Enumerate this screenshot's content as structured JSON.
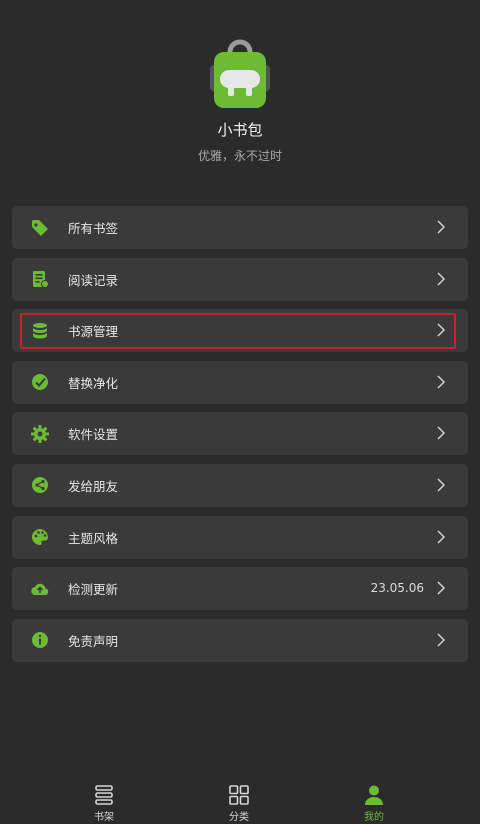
{
  "app": {
    "name": "小书包",
    "slogan": "优雅，永不过时"
  },
  "colors": {
    "accent": "#6cbb34",
    "background": "#2b2b2b",
    "card": "#3a3a3a",
    "highlight": "#c8232c"
  },
  "menu": [
    {
      "id": "bookmarks",
      "label": "所有书签",
      "icon": "tag-icon"
    },
    {
      "id": "history",
      "label": "阅读记录",
      "icon": "reading-log-icon"
    },
    {
      "id": "sources",
      "label": "书源管理",
      "icon": "database-icon"
    },
    {
      "id": "replace",
      "label": "替换净化",
      "icon": "brush-check-icon"
    },
    {
      "id": "settings",
      "label": "软件设置",
      "icon": "gear-icon"
    },
    {
      "id": "share",
      "label": "发给朋友",
      "icon": "share-icon"
    },
    {
      "id": "theme",
      "label": "主题风格",
      "icon": "palette-icon"
    },
    {
      "id": "update",
      "label": "检测更新",
      "icon": "cloud-upload-icon",
      "value": "23.05.06"
    },
    {
      "id": "disclaimer",
      "label": "免责声明",
      "icon": "info-icon"
    }
  ],
  "nav": [
    {
      "label": "书架",
      "icon": "bookshelf-icon",
      "active": false
    },
    {
      "label": "分类",
      "icon": "category-grid-icon",
      "active": false
    },
    {
      "label": "我的",
      "icon": "person-icon",
      "active": true
    }
  ]
}
